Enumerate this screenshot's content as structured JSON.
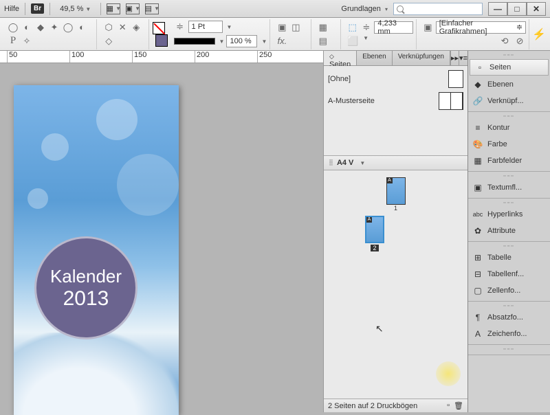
{
  "topbar": {
    "help": "Hilfe",
    "br": "Br",
    "zoom": "49,5 %",
    "workspace": "Grundlagen",
    "search_placeholder": ""
  },
  "winctrl": {
    "min": "—",
    "max": "□",
    "close": "✕"
  },
  "toolbar": {
    "stroke_weight": "1 Pt",
    "opacity": "100 %",
    "nudge": "4,233 mm",
    "fit": "[Einfacher Grafikrahmen]"
  },
  "ruler": {
    "t1": "50",
    "t2": "100",
    "t3": "150",
    "t4": "200",
    "t5": "250"
  },
  "document": {
    "title1": "Kalender",
    "title2": "2013"
  },
  "pages_panel": {
    "tabs": {
      "pages": "Seiten",
      "layers": "Ebenen",
      "links": "Verknüpfungen"
    },
    "masters": {
      "none": "[Ohne]",
      "a": "A-Musterseite"
    },
    "page_size": "A4 V",
    "page1": "1",
    "page2": "2",
    "status": "2 Seiten auf 2 Druckbögen"
  },
  "dock": {
    "seiten": "Seiten",
    "ebenen": "Ebenen",
    "verkn": "Verknüpf...",
    "kontur": "Kontur",
    "farbe": "Farbe",
    "farbfelder": "Farbfelder",
    "textumfl": "Textumfl...",
    "hyperlinks": "Hyperlinks",
    "attribute": "Attribute",
    "tabelle": "Tabelle",
    "tabellenf": "Tabellenf...",
    "zellenfo": "Zellenfo...",
    "absatzfo": "Absatzfo...",
    "zeichenfo": "Zeichenfo..."
  }
}
